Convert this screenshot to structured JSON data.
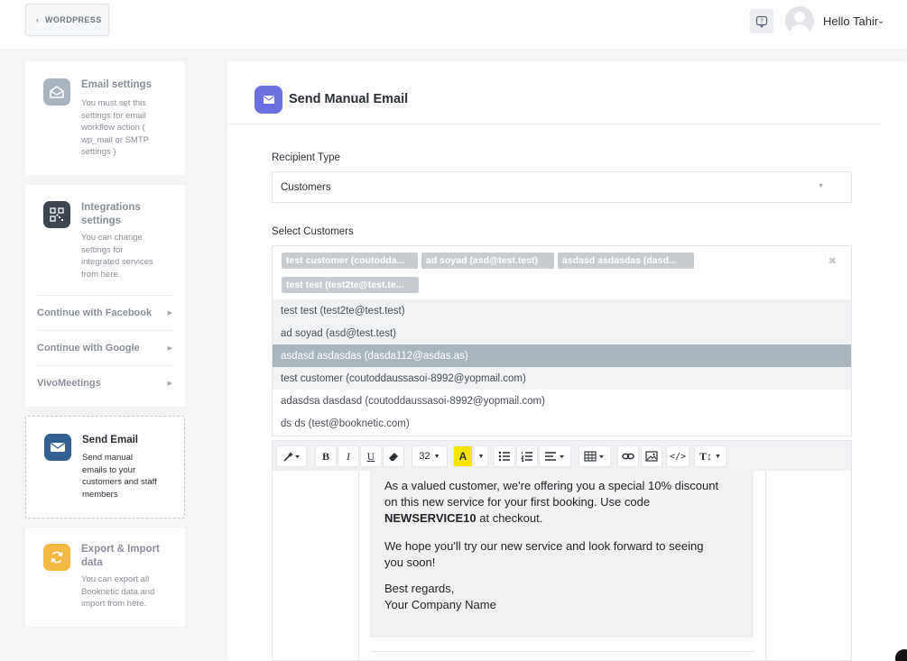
{
  "topbar": {
    "back_label": "WORDPRESS",
    "back_icon": "chevron-left-icon",
    "help_icon": "help-chat-icon",
    "user_greeting": "Hello Tahir",
    "user_menu_icon": "chevron-down-icon"
  },
  "sidebar": {
    "email_settings": {
      "title": "Email settings",
      "desc_lines": [
        "You must set this",
        "settings for email",
        "workflow action (",
        "wp_mail or SMTP",
        "settings )"
      ]
    },
    "integrations": {
      "title_lines": [
        "Integrations",
        "settings"
      ],
      "desc_lines": [
        "You can change",
        "settings for",
        "integrated services",
        "from here."
      ],
      "subitems": [
        "Continue with Facebook",
        "Continue with Google",
        "VivoMeetings"
      ]
    },
    "send_email": {
      "title": "Send Email",
      "desc_lines": [
        "Send manual",
        "emails to your",
        "customers and staff",
        "members"
      ]
    },
    "export_import": {
      "title_lines": [
        "Export & Import",
        "data"
      ],
      "desc_lines": [
        "You can export all",
        "Booknetic data and",
        "import from here."
      ]
    }
  },
  "main": {
    "title": "Send Manual Email",
    "recipient_type_label": "Recipient Type",
    "recipient_type_value": "Customers",
    "select_customers_label": "Select Customers",
    "selected_chips": [
      "test customer (coutodda...",
      "ad soyad (asd@test.test)",
      "asdasd asdasdas (dasd...",
      "test test (test2te@test.te..."
    ],
    "clear_icon": "close-x-icon",
    "options": [
      "test test (test2te@test.test)",
      "ad soyad (asd@test.test)",
      "asdasd asdasdas (dasda112@asdas.as)",
      "test customer (coutoddaussasoi-8992@yopmail.com)",
      "adasdsa dasdasd (coutoddaussasoi-8992@yopmail.com)",
      "ds ds (test@booknetic.com)"
    ],
    "highlighted_option_index": 2,
    "toolbar": {
      "font_size": "32"
    },
    "editor": {
      "p1_line1": "As a valued customer, we're offering you a special 10% discount",
      "p1_line2": "on this new service for your first booking. Use code",
      "p1_code": "NEWSERVICE10",
      "p1_after": " at checkout.",
      "p2_line1": "We hope you'll try our new service and look forward to seeing",
      "p2_line2": "you soon!",
      "p3_line1": "Best regards,",
      "p3_line2": "Your Company Name"
    }
  },
  "colors": {
    "accent": "#6c6fe0",
    "send_email_icon": "#2f5f93",
    "export_icon": "#f4b942",
    "highlight_row": "#a9b6bd",
    "chip": "#c8ccd1"
  }
}
